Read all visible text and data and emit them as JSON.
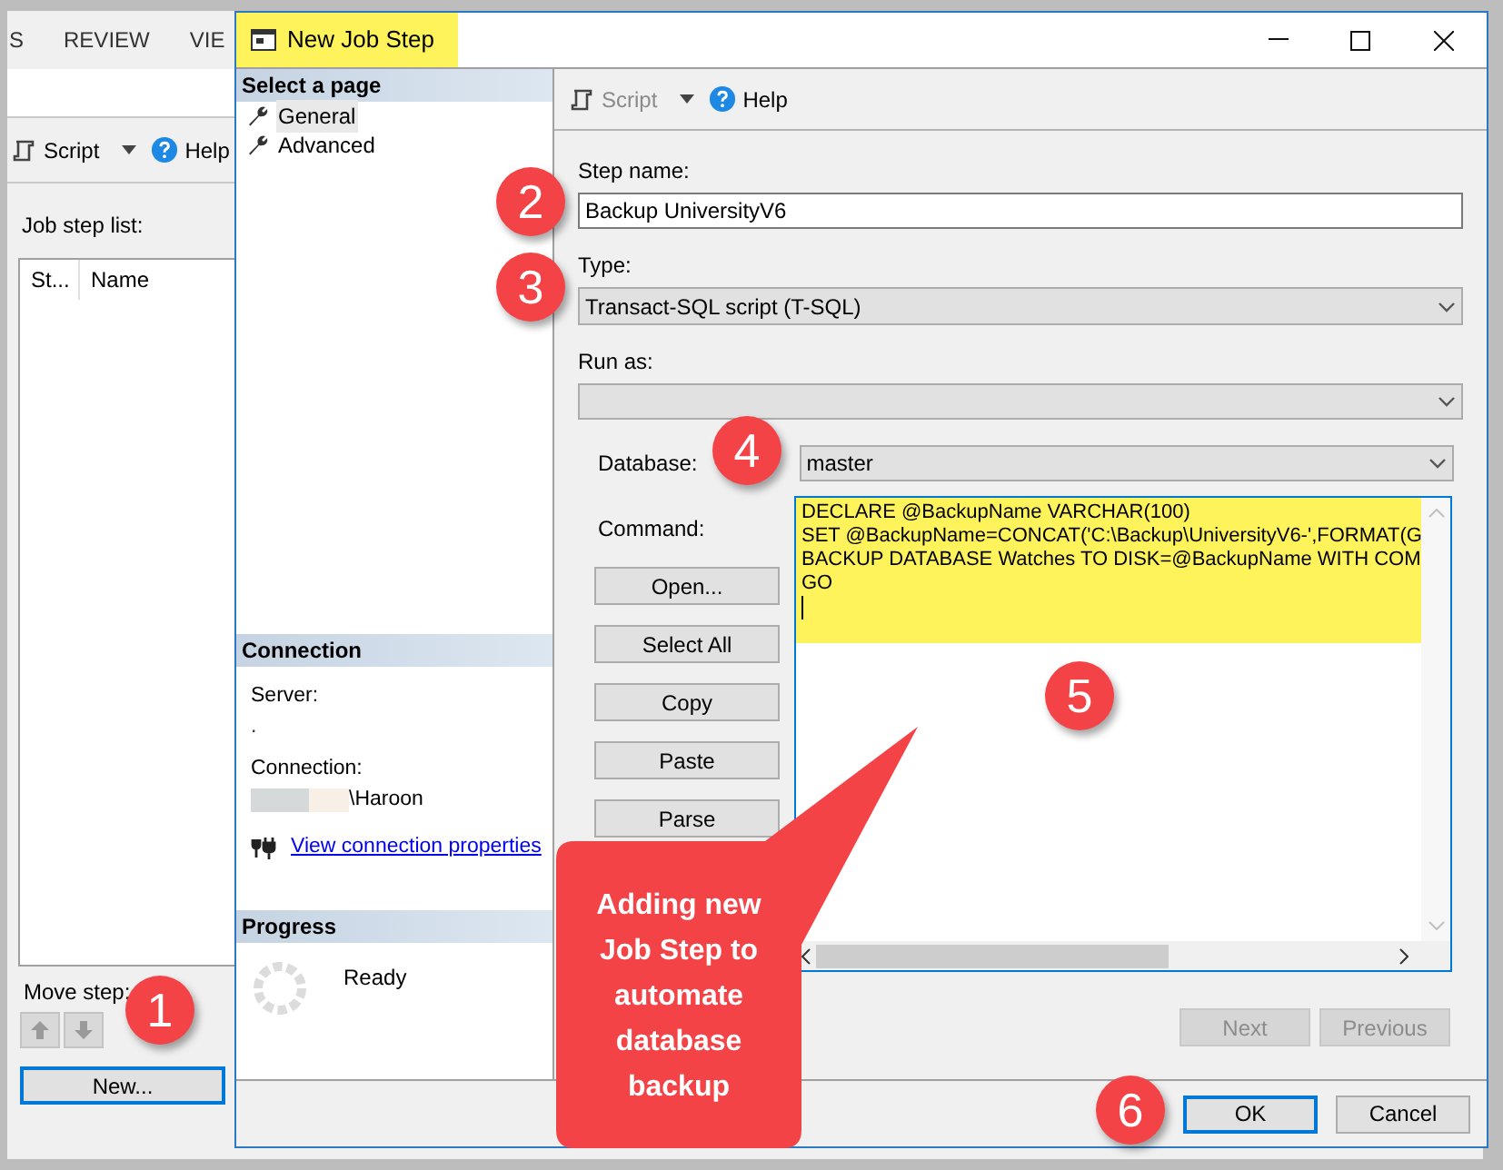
{
  "background_window": {
    "tabs": [
      "S",
      "REVIEW",
      "VIE"
    ],
    "toolbar": {
      "script": "Script",
      "help": "Help"
    },
    "job_step_list_label": "Job step list:",
    "list_columns": [
      "St...",
      "Name"
    ],
    "move_step_label": "Move step:",
    "new_button": "New..."
  },
  "dialog": {
    "title": "New Job Step",
    "pages_header": "Select a page",
    "pages": [
      {
        "label": "General",
        "selected": true
      },
      {
        "label": "Advanced",
        "selected": false
      }
    ],
    "toolbar": {
      "script": "Script",
      "help": "Help"
    },
    "connection": {
      "header": "Connection",
      "server_label": "Server:",
      "server_value": ".",
      "connection_label": "Connection:",
      "connection_value": "\\Haroon",
      "link": "View connection properties"
    },
    "progress": {
      "header": "Progress",
      "status": "Ready"
    },
    "step_name": {
      "label": "Step name:",
      "value": "Backup UniversityV6"
    },
    "type": {
      "label": "Type:",
      "value": "Transact-SQL script (T-SQL)"
    },
    "run_as": {
      "label": "Run as:"
    },
    "database": {
      "label": "Database:",
      "value": "master"
    },
    "command": {
      "label": "Command:",
      "lines": [
        "DECLARE @BackupName VARCHAR(100)",
        "SET @BackupName=CONCAT('C:\\Backup\\UniversityV6-',FORMAT(G",
        "BACKUP DATABASE Watches TO DISK=@BackupName WITH COM",
        "GO"
      ]
    },
    "command_buttons": [
      "Open...",
      "Select All",
      "Copy",
      "Paste",
      "Parse"
    ],
    "navigation": [
      {
        "label": "Next",
        "disabled": true
      },
      {
        "label": "Previous",
        "disabled": true
      }
    ],
    "footer_buttons": [
      {
        "label": "OK",
        "default": true
      },
      {
        "label": "Cancel",
        "default": false
      }
    ]
  },
  "annotations": {
    "markers": [
      "1",
      "2",
      "3",
      "4",
      "5",
      "6"
    ],
    "callout": "Adding new Job Step to automate database backup"
  }
}
